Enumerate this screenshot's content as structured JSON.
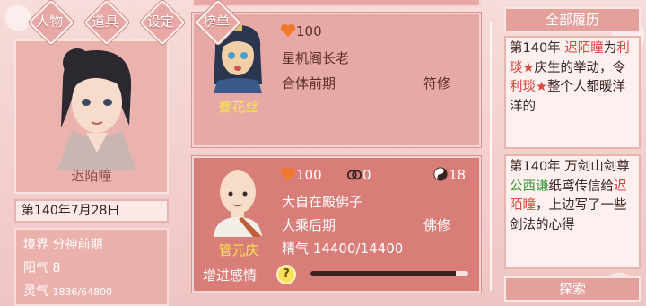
{
  "nav": {
    "items": [
      {
        "label": "人物"
      },
      {
        "label": "道具"
      },
      {
        "label": "设定"
      },
      {
        "label": "榜单"
      }
    ]
  },
  "player": {
    "name": "迟陌瞳",
    "date": "第140年7月28日",
    "realm_label": "境界",
    "realm": "分神前期",
    "yang_label": "阳气",
    "yang": "8",
    "lingqi_label": "灵气",
    "lingqi": "1836/64800"
  },
  "cards": [
    {
      "name": "夔花丝",
      "affection": "100",
      "title": "星机阁长老",
      "stage": "合体前期",
      "role": "符修"
    },
    {
      "name": "管元庆",
      "affection": "100",
      "marriage": "0",
      "karma": "18",
      "title": "大自在殿佛子",
      "stage": "大乘后期",
      "role": "佛修",
      "essence_label": "精气",
      "essence": "14400/14400",
      "action_label": "增进感情",
      "help_label": "?",
      "progress": 0.92
    }
  ],
  "history": {
    "header": "全部履历",
    "search_label": "探索",
    "entries": [
      {
        "p1": "第140年 ",
        "name1": "迟陌瞳",
        "p2": "为",
        "name2": "利琰★",
        "p3": "庆生的举动，令",
        "name3": "利琰★",
        "p4": "整个人都暖洋洋的"
      },
      {
        "p1": "第140年 万剑山剑尊",
        "name1": "公西谦",
        "p2": "纸鸢传信给",
        "name2": "迟陌瞳",
        "p3": "，上边写了一些剑法的心得"
      }
    ]
  },
  "colors": {
    "accent": "#e4a19c",
    "highlight_name": "#d8463f",
    "highlight_green": "#3c9a3a",
    "heart": "#f07a2a",
    "npc_name": "#f7e84a"
  }
}
